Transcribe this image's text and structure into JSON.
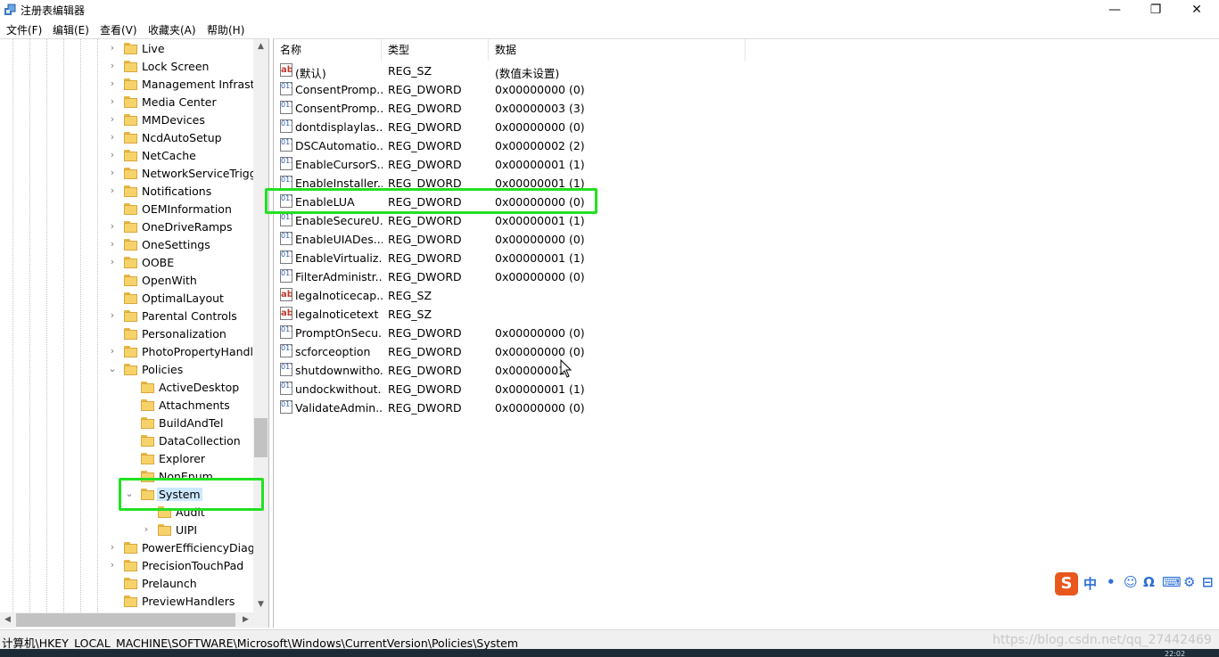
{
  "window": {
    "title": "注册表编辑器",
    "min": "—",
    "max": "❐",
    "close": "✕"
  },
  "menu": [
    "文件(F)",
    "编辑(E)",
    "查看(V)",
    "收藏夹(A)",
    "帮助(H)"
  ],
  "tree": {
    "items": [
      {
        "label": "Live",
        "arrow": "›"
      },
      {
        "label": "Lock Screen",
        "arrow": "›"
      },
      {
        "label": "Management Infrastr",
        "arrow": "›"
      },
      {
        "label": "Media Center",
        "arrow": "›"
      },
      {
        "label": "MMDevices",
        "arrow": "›"
      },
      {
        "label": "NcdAutoSetup",
        "arrow": "›"
      },
      {
        "label": "NetCache",
        "arrow": "›"
      },
      {
        "label": "NetworkServiceTrigge",
        "arrow": "›"
      },
      {
        "label": "Notifications",
        "arrow": "›"
      },
      {
        "label": "OEMInformation",
        "arrow": ""
      },
      {
        "label": "OneDriveRamps",
        "arrow": "›"
      },
      {
        "label": "OneSettings",
        "arrow": "›"
      },
      {
        "label": "OOBE",
        "arrow": "›"
      },
      {
        "label": "OpenWith",
        "arrow": ""
      },
      {
        "label": "OptimalLayout",
        "arrow": ""
      },
      {
        "label": "Parental Controls",
        "arrow": "›"
      },
      {
        "label": "Personalization",
        "arrow": ""
      },
      {
        "label": "PhotoPropertyHandle",
        "arrow": "›"
      },
      {
        "label": "Policies",
        "arrow": "⌄"
      },
      {
        "label": "ActiveDesktop",
        "arrow": ""
      },
      {
        "label": "Attachments",
        "arrow": ""
      },
      {
        "label": "BuildAndTel",
        "arrow": ""
      },
      {
        "label": "DataCollection",
        "arrow": ""
      },
      {
        "label": "Explorer",
        "arrow": ""
      },
      {
        "label": "NonEnum",
        "arrow": ""
      },
      {
        "label": "System",
        "arrow": "⌄"
      },
      {
        "label": "Audit",
        "arrow": ""
      },
      {
        "label": "UIPI",
        "arrow": "›"
      },
      {
        "label": "PowerEfficiencyDiagn",
        "arrow": "›"
      },
      {
        "label": "PrecisionTouchPad",
        "arrow": "›"
      },
      {
        "label": "Prelaunch",
        "arrow": ""
      },
      {
        "label": "PreviewHandlers",
        "arrow": ""
      }
    ],
    "scroll": {
      "up": "▲",
      "down": "▼",
      "left": "◀",
      "right": "▶"
    }
  },
  "values": {
    "headers": [
      "名称",
      "类型",
      "数据"
    ],
    "rows": [
      {
        "name": "(默认)",
        "type": "REG_SZ",
        "data": "(数值未设置)",
        "icon": "ab"
      },
      {
        "name": "ConsentPromp...",
        "type": "REG_DWORD",
        "data": "0x00000000 (0)",
        "icon": "011"
      },
      {
        "name": "ConsentPromp...",
        "type": "REG_DWORD",
        "data": "0x00000003 (3)",
        "icon": "011"
      },
      {
        "name": "dontdisplaylas...",
        "type": "REG_DWORD",
        "data": "0x00000000 (0)",
        "icon": "011"
      },
      {
        "name": "DSCAutomatio...",
        "type": "REG_DWORD",
        "data": "0x00000002 (2)",
        "icon": "011"
      },
      {
        "name": "EnableCursorS...",
        "type": "REG_DWORD",
        "data": "0x00000001 (1)",
        "icon": "011"
      },
      {
        "name": "EnableInstaller...",
        "type": "REG_DWORD",
        "data": "0x00000001 (1)",
        "icon": "011"
      },
      {
        "name": "EnableLUA",
        "type": "REG_DWORD",
        "data": "0x00000000 (0)",
        "icon": "011"
      },
      {
        "name": "EnableSecureU...",
        "type": "REG_DWORD",
        "data": "0x00000001 (1)",
        "icon": "011"
      },
      {
        "name": "EnableUIADes...",
        "type": "REG_DWORD",
        "data": "0x00000000 (0)",
        "icon": "011"
      },
      {
        "name": "EnableVirtualiz...",
        "type": "REG_DWORD",
        "data": "0x00000001 (1)",
        "icon": "011"
      },
      {
        "name": "FilterAdministr...",
        "type": "REG_DWORD",
        "data": "0x00000000 (0)",
        "icon": "011"
      },
      {
        "name": "legalnoticecap...",
        "type": "REG_SZ",
        "data": "",
        "icon": "ab"
      },
      {
        "name": "legalnoticetext",
        "type": "REG_SZ",
        "data": "",
        "icon": "ab"
      },
      {
        "name": "PromptOnSecu...",
        "type": "REG_DWORD",
        "data": "0x00000000 (0)",
        "icon": "011"
      },
      {
        "name": "scforceoption",
        "type": "REG_DWORD",
        "data": "0x00000000 (0)",
        "icon": "011"
      },
      {
        "name": "shutdownwitho...",
        "type": "REG_DWORD",
        "data": "0x00000001",
        "icon": "011"
      },
      {
        "name": "undockwithout...",
        "type": "REG_DWORD",
        "data": "0x00000001 (1)",
        "icon": "011"
      },
      {
        "name": "ValidateAdmin...",
        "type": "REG_DWORD",
        "data": "0x00000000 (0)",
        "icon": "011"
      }
    ]
  },
  "ime": {
    "logo": "S",
    "items": [
      "中",
      "•",
      "☺",
      "Ω",
      "⌨",
      "⚙",
      "⊟"
    ]
  },
  "status": {
    "path": "计算机\\HKEY_LOCAL_MACHINE\\SOFTWARE\\Microsoft\\Windows\\CurrentVersion\\Policies\\System",
    "watermark": "https://blog.csdn.net/qq_27442469",
    "clock": "22:02"
  },
  "colors": {
    "highlight": "#22e022",
    "selection": "#cce8ff",
    "folder": "#f6d36a"
  }
}
